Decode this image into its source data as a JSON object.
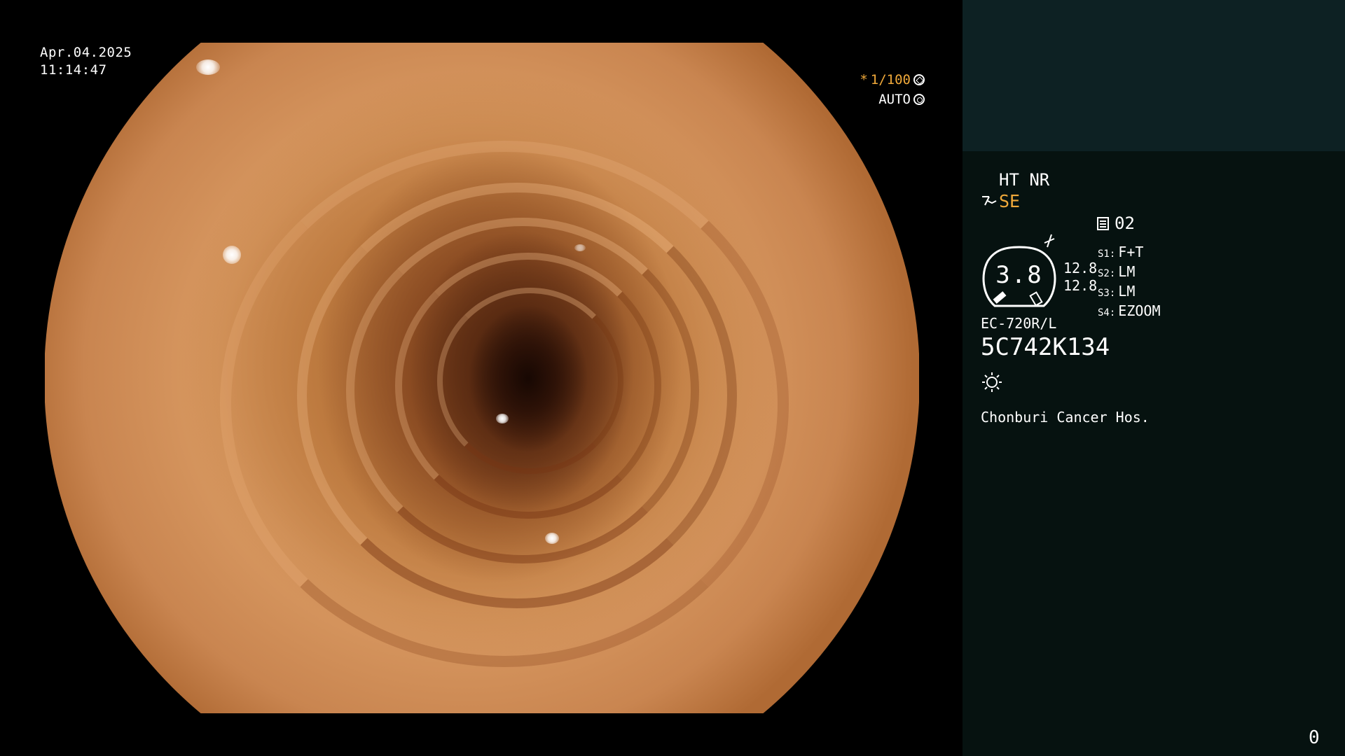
{
  "overlay": {
    "date": "Apr.04.2025",
    "time": "11:14:47",
    "shutter_prefix": "*",
    "shutter_value": "1/100",
    "iris_mode": "AUTO"
  },
  "panel": {
    "image_modes": "HT NR",
    "structure_enhance": "SE",
    "memo_number": "02",
    "gauge_value": "3.8",
    "gauge_readings": [
      "12.8",
      "12.8"
    ],
    "switches": [
      {
        "key": "S1:",
        "value": "F+T"
      },
      {
        "key": "S2:",
        "value": "LM"
      },
      {
        "key": "S3:",
        "value": "LM"
      },
      {
        "key": "S4:",
        "value": "EZOOM"
      }
    ],
    "scope_model": "EC-720R/L",
    "scope_serial": "5C742K134",
    "hospital": "Chonburi Cancer Hos.",
    "counter": "0"
  },
  "icons": {
    "shutter": "shutter-icon",
    "iris": "iris-icon",
    "se": "structure-enhance-icon",
    "enhance": "color-enhance-icon",
    "memo": "memo-icon",
    "light": "light-icon"
  },
  "colors": {
    "accent": "#f0a93a",
    "panel_bg": "#061210",
    "panel_header_bg": "#0d2123",
    "text": "#ffffff"
  }
}
